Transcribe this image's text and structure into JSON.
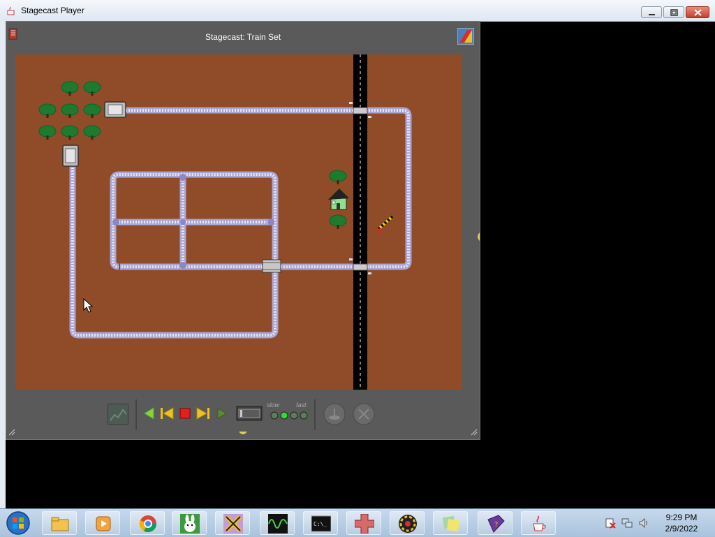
{
  "window": {
    "title": "Stagecast Player",
    "buttons": {
      "minimize": "minimize",
      "maximize": "maximize",
      "close": "close"
    }
  },
  "player": {
    "stage_title": "Stagecast: Train Set",
    "speed_slow_label": "slow",
    "speed_fast_label": "fast",
    "speed_level": 2
  },
  "colors": {
    "stage_background": "#904b28",
    "track": "#a9a6c8",
    "road": "#000000",
    "player_frame": "#5a5a5a"
  },
  "taskbar": {
    "items": [
      "start-orb",
      "file-explorer",
      "media-player",
      "chrome",
      "rabbit-app",
      "crossroads-app",
      "oscilloscope-app",
      "command-prompt",
      "pattern-app",
      "puzzle-app",
      "sticky-notes",
      "help-book",
      "java"
    ],
    "clock_time": "9:29 PM",
    "clock_date": "2/9/2022"
  }
}
